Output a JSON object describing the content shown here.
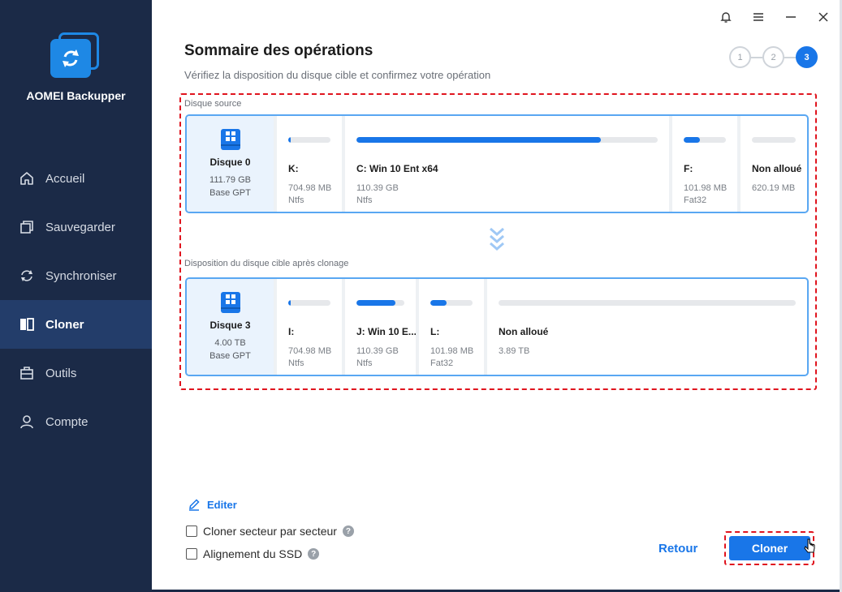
{
  "app": {
    "name": "AOMEI Backupper"
  },
  "nav": {
    "items": [
      {
        "label": "Accueil",
        "icon": "home-icon",
        "active": false
      },
      {
        "label": "Sauvegarder",
        "icon": "backup-icon",
        "active": false
      },
      {
        "label": "Synchroniser",
        "icon": "sync-icon",
        "active": false
      },
      {
        "label": "Cloner",
        "icon": "clone-icon",
        "active": true
      },
      {
        "label": "Outils",
        "icon": "tools-icon",
        "active": false
      },
      {
        "label": "Compte",
        "icon": "account-icon",
        "active": false
      }
    ]
  },
  "header": {
    "title": "Sommaire des opérations",
    "subtitle": "Vérifiez la disposition du disque cible et confirmez votre opération",
    "steps": [
      "1",
      "2",
      "3"
    ],
    "active_step": 3
  },
  "source": {
    "label": "Disque source",
    "disk": {
      "name": "Disque 0",
      "size": "111.79 GB",
      "type": "Base GPT"
    },
    "partitions": [
      {
        "name": "K:",
        "size": "704.98 MB",
        "fs": "Ntfs",
        "used": 0.05
      },
      {
        "name": "C: Win 10 Ent x64",
        "size": "110.39 GB",
        "fs": "Ntfs",
        "used": 0.81
      },
      {
        "name": "F:",
        "size": "101.98 MB",
        "fs": "Fat32",
        "used": 0.38
      },
      {
        "name": "Non alloué",
        "size": "620.19 MB",
        "fs": "",
        "used": 0
      }
    ]
  },
  "target": {
    "label": "Disposition du disque cible après clonage",
    "disk": {
      "name": "Disque 3",
      "size": "4.00 TB",
      "type": "Base GPT"
    },
    "partitions": [
      {
        "name": "I:",
        "size": "704.98 MB",
        "fs": "Ntfs",
        "used": 0.05
      },
      {
        "name": "J: Win 10 E...",
        "size": "110.39 GB",
        "fs": "Ntfs",
        "used": 0.82
      },
      {
        "name": "L:",
        "size": "101.98 MB",
        "fs": "Fat32",
        "used": 0.38
      },
      {
        "name": "Non alloué",
        "size": "3.89 TB",
        "fs": "",
        "used": 0
      }
    ]
  },
  "options": {
    "edit_label": "Editer",
    "sector_label": "Cloner secteur par secteur",
    "ssd_label": "Alignement du SSD",
    "help": "?"
  },
  "footer": {
    "back_label": "Retour",
    "clone_label": "Cloner"
  },
  "colors": {
    "accent": "#1976e8",
    "sidebar": "#1b2a47",
    "highlight": "#e0141e"
  }
}
